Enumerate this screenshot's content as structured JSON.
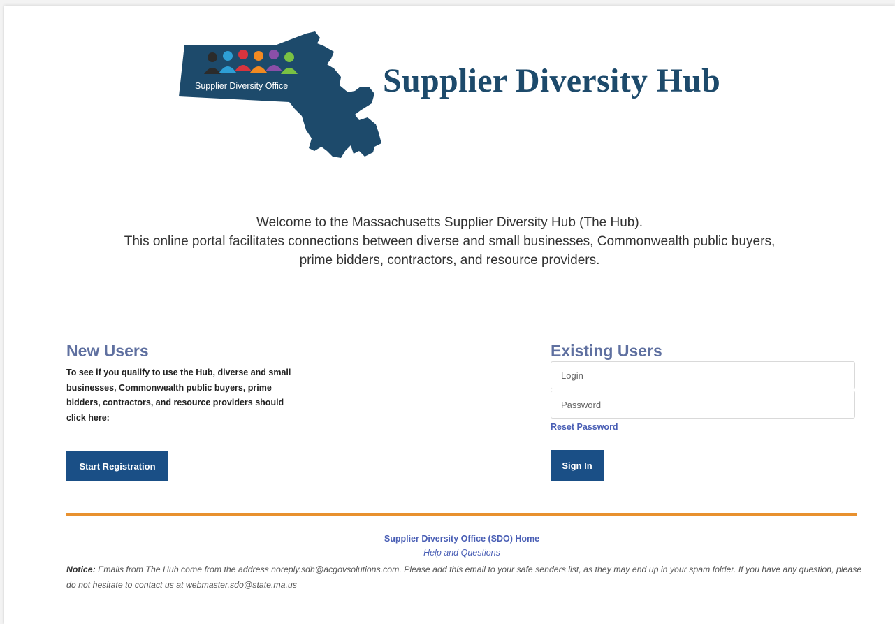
{
  "header": {
    "logo_label": "Supplier Diversity Office",
    "title": "Supplier Diversity Hub"
  },
  "welcome": {
    "line1": "Welcome to the Massachusetts Supplier Diversity Hub (The Hub).",
    "line2": "This online portal facilitates connections between diverse and small businesses, Commonwealth public buyers,",
    "line3": "prime bidders, contractors, and resource providers."
  },
  "new_users": {
    "title": "New Users",
    "description": "To see if you qualify to use the Hub, diverse and small businesses, Commonwealth public buyers, prime bidders, contractors, and resource providers should click here:",
    "button_label": "Start Registration"
  },
  "existing_users": {
    "title": "Existing Users",
    "login_placeholder": "Login",
    "password_placeholder": "Password",
    "reset_label": "Reset Password",
    "signin_label": "Sign In"
  },
  "footer": {
    "home_link": "Supplier Diversity Office (SDO) Home",
    "help_link": "Help and Questions",
    "notice_label": "Notice:",
    "notice_text": " Emails from The Hub come from the address noreply.sdh@acgovsolutions.com. Please add this email to your safe senders list, as they may end up in your spam folder. If you have any question, please do not hesitate to contact us at webmaster.sdo@state.ma.us"
  },
  "colors": {
    "brand_navy": "#1d4a6b",
    "button_blue": "#1a4f86",
    "heading_purple": "#5f70a0",
    "link_blue": "#4a5fb5",
    "divider_orange": "#e8912f"
  }
}
